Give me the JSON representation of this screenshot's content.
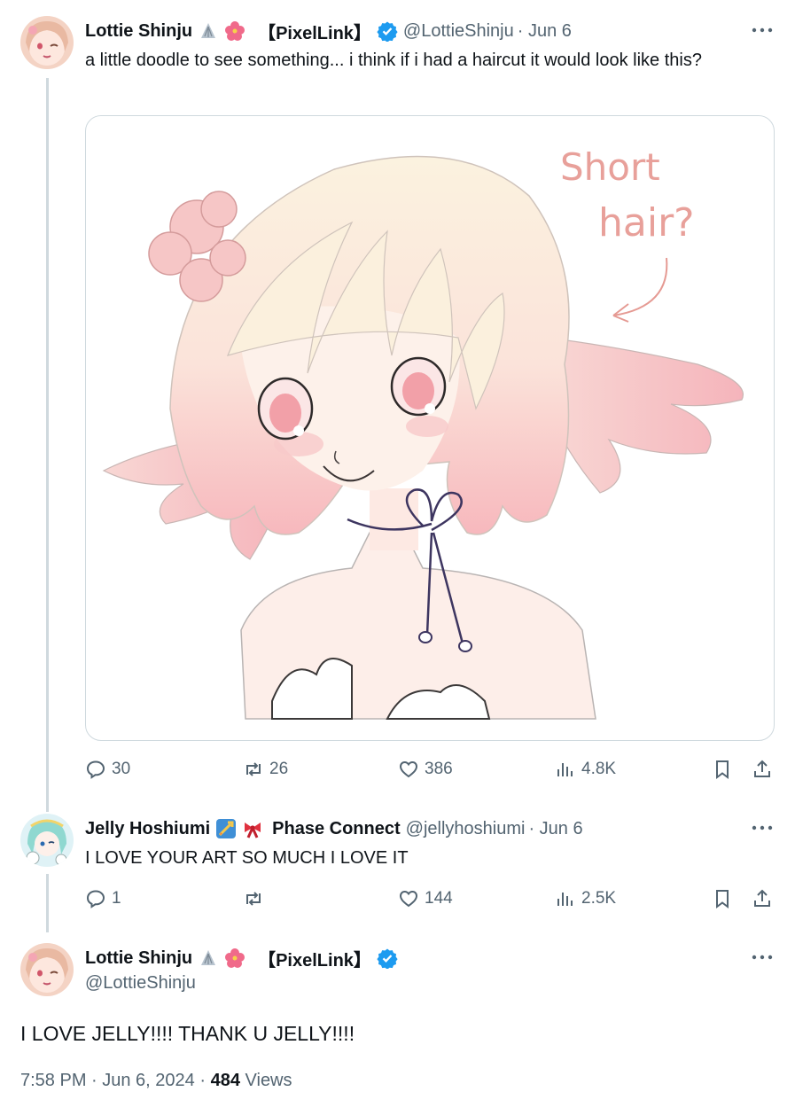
{
  "thread": {
    "post1": {
      "display_name": "Lottie Shinju",
      "affiliation": "【PixelLink】",
      "handle": "@LottieShinju",
      "date": "· Jun 6",
      "text": "a little doodle to see something... i think if i had a haircut it would look like this?",
      "image_annotation_line1": "Short",
      "image_annotation_line2": "hair?",
      "stats": {
        "replies": "30",
        "reposts": "26",
        "likes": "386",
        "views": "4.8K"
      }
    },
    "post2": {
      "display_name": "Jelly Hoshiumi",
      "affiliation": "Phase Connect",
      "handle": "@jellyhoshiumi",
      "date": "· Jun 6",
      "text": "I LOVE YOUR ART SO MUCH I LOVE IT",
      "stats": {
        "replies": "1",
        "reposts": "",
        "likes": "144",
        "views": "2.5K"
      }
    },
    "main_post": {
      "display_name": "Lottie Shinju",
      "affiliation": "【PixelLink】",
      "handle": "@LottieShinju",
      "text": "I LOVE JELLY!!!! THANK U JELLY!!!!",
      "timestamp": "7:58 PM · Jun 6, 2024 ·",
      "views_count": "484",
      "views_label": "Views"
    }
  },
  "colors": {
    "text": "#0f1419",
    "secondary": "#536471",
    "verified": "#1d9bf0",
    "thread_line": "#cfd9de",
    "annotation": "#e8a09a"
  },
  "icons": [
    "more-icon",
    "verified-icon",
    "shell-emoji-icon",
    "hibiscus-emoji-icon",
    "reply-icon",
    "repost-icon",
    "like-icon",
    "views-icon",
    "bookmark-icon",
    "share-icon",
    "rocket-emoji-icon",
    "ribbon-emoji-icon"
  ]
}
